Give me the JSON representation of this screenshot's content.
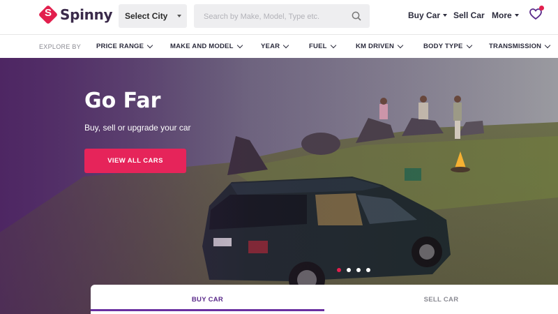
{
  "brand": {
    "name": "Spinny",
    "mark_letter": "S",
    "color": "#e21f4d"
  },
  "header": {
    "city_label": "Select City",
    "search_placeholder": "Search by Make, Model, Type etc.",
    "nav": {
      "buy_car": "Buy Car",
      "sell_car": "Sell Car",
      "more": "More"
    },
    "icons": [
      "chevron-down-icon",
      "search-icon",
      "heart-icon"
    ]
  },
  "filters": {
    "explore_label": "EXPLORE BY",
    "items": [
      "PRICE RANGE",
      "MAKE AND MODEL",
      "YEAR",
      "FUEL",
      "KM DRIVEN",
      "BODY TYPE",
      "TRANSMISSION"
    ]
  },
  "hero": {
    "title": "Go Far",
    "subtitle": "Buy, sell or upgrade your car",
    "cta": "VIEW ALL CARS",
    "cta_color": "#e6245a",
    "slides": {
      "count": 4,
      "active": 1
    }
  },
  "tabs": {
    "buy": "BUY CAR",
    "sell": "SELL CAR",
    "active": "buy",
    "accent": "#6a2fa0"
  }
}
